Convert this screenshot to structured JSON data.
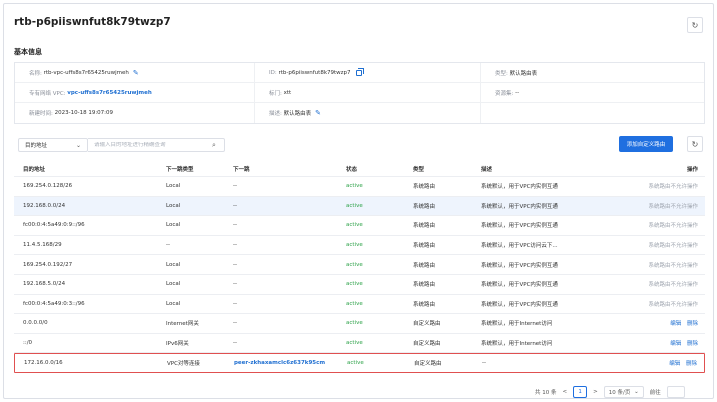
{
  "header": {
    "title": "rtb-p6piiswnfut8k79twzp7",
    "refresh_icon": "refresh-icon"
  },
  "basic_info": {
    "section_title": "基本信息",
    "name": {
      "label": "名称:",
      "value": "rtb-vpc-uffs8s7r65425ruwjmeh"
    },
    "id": {
      "label": "ID:",
      "value": "rtb-p6piiswnfut8k79twzp7"
    },
    "type": {
      "label": "类型:",
      "value": "默认路由表"
    },
    "vpc": {
      "label": "专有网络 VPC:",
      "value": "vpc-uffs8s7r65425ruwjmeh"
    },
    "tag": {
      "label": "标门:",
      "value": "xtt"
    },
    "resource_set": {
      "label": "资源集:",
      "value": "--"
    },
    "created": {
      "label": "新建时间:",
      "value": "2023-10-18 19:07:09"
    },
    "desc": {
      "label": "描述:",
      "value": "默认路由表"
    }
  },
  "toolbar": {
    "filter_select": "目的地址",
    "search_placeholder": "请输入目的地址进行精确查询",
    "add_button": "添加自定义路由"
  },
  "table": {
    "headers": [
      "目的地址",
      "下一跳类型",
      "下一跳",
      "状态",
      "类型",
      "描述",
      "操作"
    ],
    "rows": [
      {
        "dest": "169.254.0.128/26",
        "hop_type": "Local",
        "hop": "--",
        "status": "active",
        "type": "系统路由",
        "desc": "系统默认，用于VPC内实例互通",
        "op": "系统路由不允许操作"
      },
      {
        "dest": "192.168.0.0/24",
        "hop_type": "Local",
        "hop": "--",
        "status": "active",
        "type": "系统路由",
        "desc": "系统默认，用于VPC内实例互通",
        "op": "系统路由不允许操作"
      },
      {
        "dest": "fc00:0:4:5a49:0:9::/96",
        "hop_type": "Local",
        "hop": "--",
        "status": "active",
        "type": "系统路由",
        "desc": "系统默认，用于VPC内实例互通",
        "op": "系统路由不允许操作"
      },
      {
        "dest": "11.4.5.168/29",
        "hop_type": "--",
        "hop": "--",
        "status": "active",
        "type": "系统路由",
        "desc": "系统默认，用于VPC访问云下...",
        "op": "系统路由不允许操作"
      },
      {
        "dest": "169.254.0.192/27",
        "hop_type": "Local",
        "hop": "--",
        "status": "active",
        "type": "系统路由",
        "desc": "系统默认，用于VPC内实例互通",
        "op": "系统路由不允许操作"
      },
      {
        "dest": "192.168.5.0/24",
        "hop_type": "Local",
        "hop": "--",
        "status": "active",
        "type": "系统路由",
        "desc": "系统默认，用于VPC内实例互通",
        "op": "系统路由不允许操作"
      },
      {
        "dest": "fc00:0:4:5a49:0:3::/96",
        "hop_type": "Local",
        "hop": "--",
        "status": "active",
        "type": "系统路由",
        "desc": "系统默认，用于VPC内实例互通",
        "op": "系统路由不允许操作"
      },
      {
        "dest": "0.0.0.0/0",
        "hop_type": "Internet网关",
        "hop": "--",
        "status": "active",
        "type": "自定义路由",
        "desc": "系统默认，用于Internet访问",
        "op_edit": "编辑",
        "op_delete": "删除"
      },
      {
        "dest": "::/0",
        "hop_type": "IPv6网关",
        "hop": "--",
        "status": "active",
        "type": "自定义路由",
        "desc": "系统默认，用于Internet访问",
        "op_edit": "编辑",
        "op_delete": "删除"
      },
      {
        "dest": "172.16.0.0/16",
        "hop_type": "VPC对等连接",
        "hop": "peer-zkhaxamclc6z637k95cm",
        "status": "active",
        "type": "自定义路由",
        "desc": "--",
        "op_edit": "编辑",
        "op_delete": "删除"
      }
    ]
  },
  "pagination": {
    "total": "共 10 条",
    "prev": "<",
    "current": "1",
    "next": ">",
    "page_size": "10 条/页",
    "goto": "前往"
  }
}
